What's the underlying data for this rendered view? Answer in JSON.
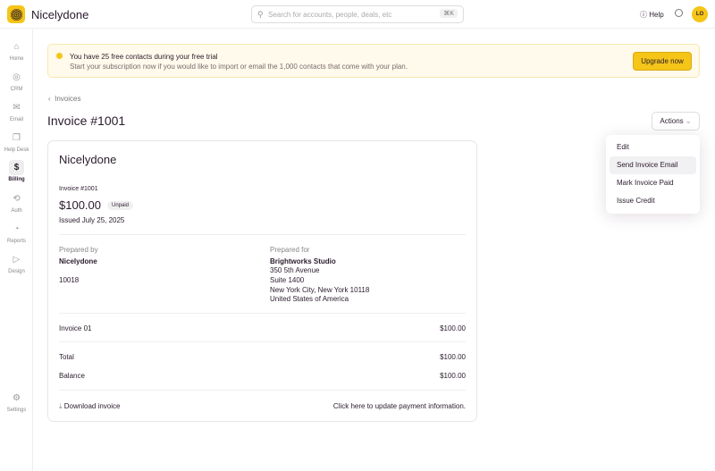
{
  "app": {
    "name": "Nicelydone",
    "search_placeholder": "Search for accounts, people, deals, etc",
    "search_shortcut": "⌘K",
    "help": "Help",
    "avatar": "LO"
  },
  "sidebar": [
    {
      "label": "Home",
      "icon": "⌂"
    },
    {
      "label": "CRM",
      "icon": "◎"
    },
    {
      "label": "Email",
      "icon": "✉"
    },
    {
      "label": "Help Desk",
      "icon": "❐"
    },
    {
      "label": "Billing",
      "icon": "$"
    },
    {
      "label": "Auth",
      "icon": "⟲"
    },
    {
      "label": "Reports",
      "icon": "◔"
    },
    {
      "label": "Design",
      "icon": "▷"
    }
  ],
  "settings": {
    "label": "Settings",
    "icon": "⚙"
  },
  "banner": {
    "title": "You have 25 free contacts during your free trial",
    "text": "Start your subscription now if you would like to import or email the 1,000 contacts that come with your plan.",
    "button": "Upgrade now"
  },
  "breadcrumb": "Invoices",
  "title": "Invoice #1001",
  "actions": {
    "label": "Actions",
    "items": [
      "Edit",
      "Send Invoice Email",
      "Mark Invoice Paid",
      "Issue Credit"
    ]
  },
  "invoice": {
    "company": "Nicelydone",
    "number": "Invoice #1001",
    "amount": "$100.00",
    "status": "Unpaid",
    "issued": "Issued July 25, 2025",
    "prepared_by_label": "Prepared by",
    "prepared_by": "Nicelydone",
    "prepared_by_zip": "10018",
    "prepared_for_label": "Prepared for",
    "prepared_for": [
      "Brightworks Studio",
      "350 5th Avenue",
      "Suite 1400",
      "New York City, New York 10118",
      "United States of America"
    ],
    "line_item": "Invoice 01",
    "line_amount": "$100.00",
    "total_label": "Total",
    "total": "$100.00",
    "balance_label": "Balance",
    "balance": "$100.00",
    "download": "Download invoice",
    "update_payment": "Click here to update payment information."
  }
}
